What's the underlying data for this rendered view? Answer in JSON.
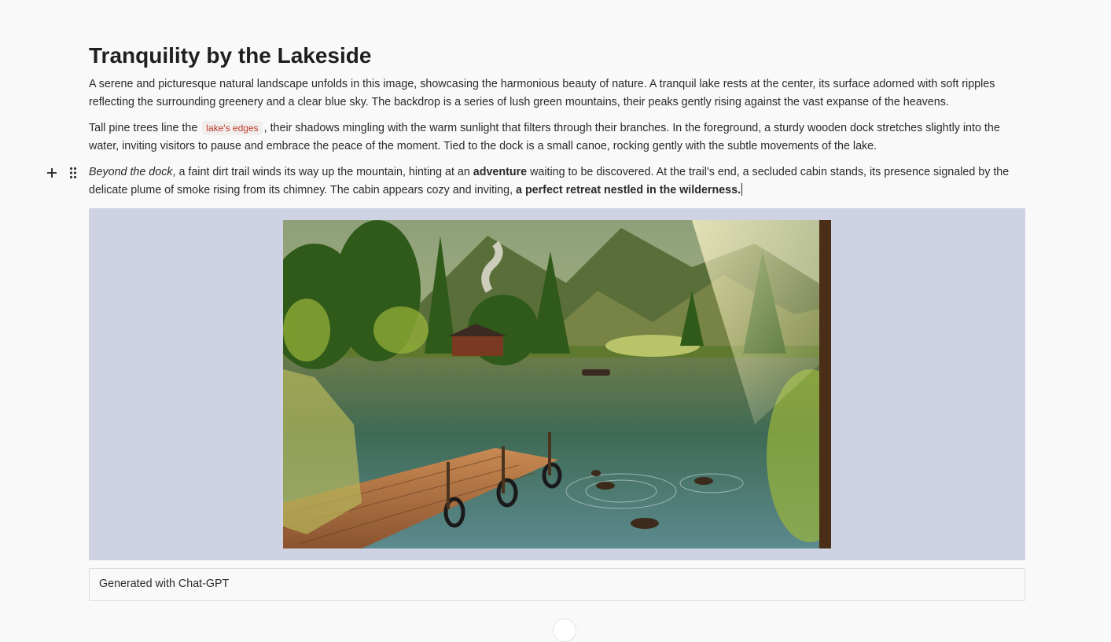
{
  "document": {
    "title": "Tranquility by the Lakeside",
    "paragraph1": "A serene and picturesque natural landscape unfolds in this image, showcasing the harmonious beauty of nature. A tranquil lake rests at the center, its surface adorned with soft ripples reflecting the surrounding greenery and a clear blue sky. The backdrop is a series of lush green mountains, their peaks gently rising against the vast expanse of the heavens.",
    "paragraph2": {
      "before": "Tall pine trees line the",
      "code": "lake's edges",
      "after": ", their shadows mingling with the warm sunlight that filters through their branches. In the foreground, a sturdy wooden dock stretches slightly into the water, inviting visitors to pause and embrace the peace of the moment. Tied to the dock is a small canoe, rocking gently with the subtle movements of the lake."
    },
    "paragraph3": {
      "italic": "Beyond the dock",
      "part1": ", a faint dirt trail winds its way up the mountain, hinting at an ",
      "bold1": "adventure",
      "part2": " waiting to be discovered. At the trail's end, a secluded cabin stands, its presence signaled by the delicate plume of smoke rising from its chimney. The cabin appears cozy and inviting, ",
      "bold2": "a perfect retreat nestled in the wilderness."
    },
    "image_caption": "Generated with Chat-GPT"
  },
  "icons": {
    "add_block": "plus-icon",
    "drag_handle": "drag-handle-icon"
  },
  "colors": {
    "background": "#f9f9f9",
    "image_block_bg": "#cfd2e2",
    "inline_code": "#c0392b"
  }
}
